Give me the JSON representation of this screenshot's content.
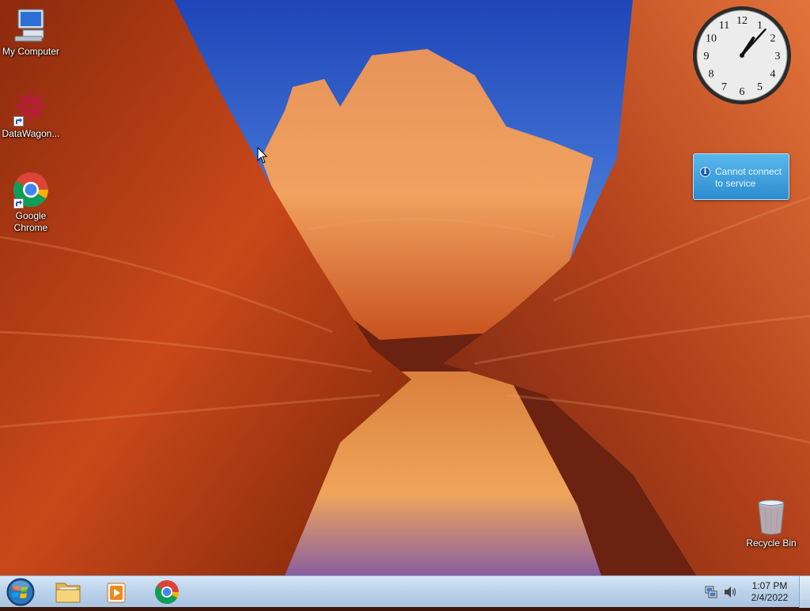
{
  "desktop": {
    "icons": [
      {
        "label": "My Computer",
        "icon": "computer-icon"
      },
      {
        "label": "DataWagon...",
        "icon": "datawagon-icon"
      },
      {
        "label": "Google\nChrome",
        "icon": "chrome-icon"
      },
      {
        "label": "Recycle Bin",
        "icon": "recycle-bin-icon"
      }
    ]
  },
  "gadgets": {
    "clock": {
      "time": "1:07",
      "numerals": [
        "12",
        "1",
        "2",
        "3",
        "4",
        "5",
        "6",
        "7",
        "8",
        "9",
        "10",
        "11"
      ]
    },
    "notification": {
      "text": "Cannot connect to service",
      "icon": "info-icon"
    }
  },
  "taskbar": {
    "start_icon": "windows-start-orb",
    "pinned": [
      {
        "name": "File Explorer",
        "icon": "folder-icon"
      },
      {
        "name": "Windows Media Player",
        "icon": "media-player-icon"
      },
      {
        "name": "Google Chrome",
        "icon": "chrome-icon"
      }
    ],
    "tray": {
      "icons": [
        "network-icon",
        "volume-icon"
      ],
      "time": "1:07 PM",
      "date": "2/4/2022"
    }
  },
  "colors": {
    "taskbar": "#bcd3ea",
    "notification": "#3a9ad8",
    "sky": "#2f5fc9"
  }
}
